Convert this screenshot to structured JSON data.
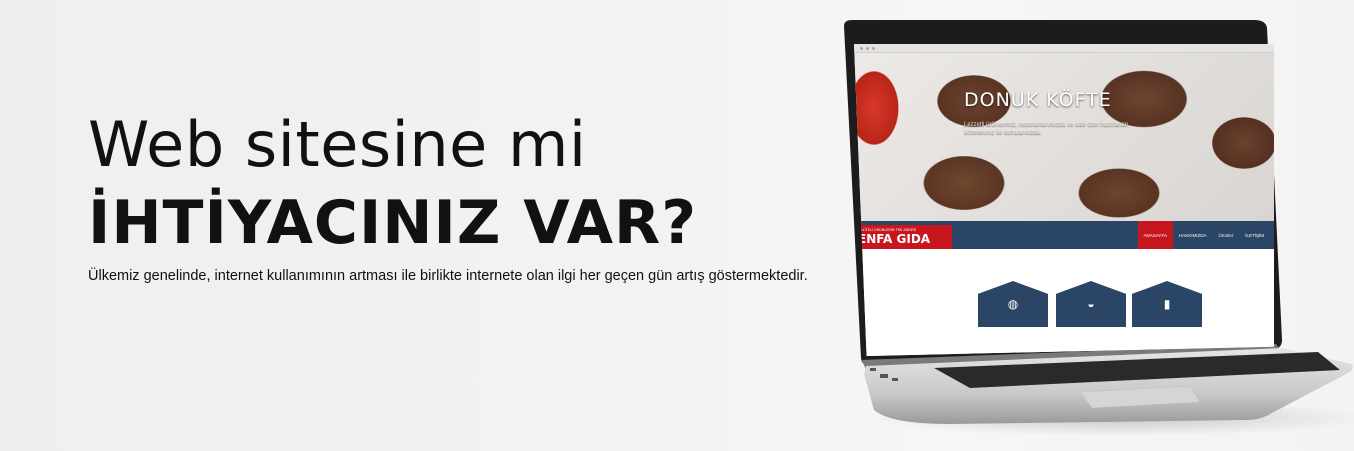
{
  "hero": {
    "headline_line1": "Web sitesine mi",
    "headline_line2": "İHTİYACINIZ VAR?",
    "subtext": "Ülkemiz genelinde, internet kullanımının artması ile birlikte internete olan ilgi her geçen gün artış göstermektedir."
  },
  "laptop_site": {
    "hero_title": "DONUK KÖFTE",
    "hero_desc": "Lezzetli ürünlerimiz, restoranlarımızda ve size özel hazırlanan köftelerimiz ile sofralarınızda.",
    "logo_small": "KALİTELİ ÜRÜNLERİN TEK ADRESİ",
    "logo": "ENFA GIDA",
    "nav": [
      "ANASAYFA",
      "HAKKIMIZDA",
      "Ürünler",
      "İLETİŞİM"
    ],
    "service_icons": [
      "drink-icon",
      "food-icon",
      "product-icon"
    ]
  },
  "colors": {
    "brand_red": "#c8161e",
    "brand_navy": "#2a4566"
  }
}
